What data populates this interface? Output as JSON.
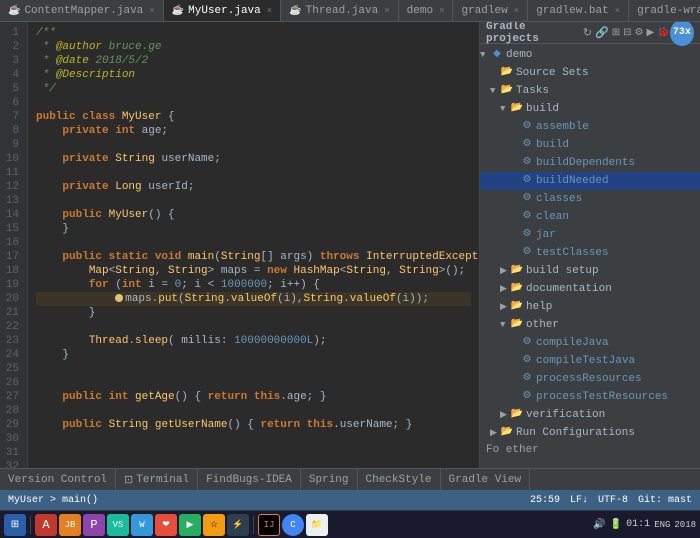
{
  "tabs": [
    {
      "label": "ContentMapper.java",
      "icon": "☕",
      "active": false
    },
    {
      "label": "MyUser.java",
      "icon": "☕",
      "active": true
    },
    {
      "label": "Thread.java",
      "icon": "☕",
      "active": false
    },
    {
      "label": "demo",
      "icon": "📁",
      "active": false
    },
    {
      "label": "gradlew",
      "icon": "📄",
      "active": false
    },
    {
      "label": "gradlew.bat",
      "icon": "📄",
      "active": false
    },
    {
      "label": "gradle-wrapper.properties",
      "icon": "📄",
      "active": false
    }
  ],
  "editor": {
    "filename": "MyUser.java",
    "breadcrumb": "MyUser > main()"
  },
  "gradle": {
    "title": "Gradle projects",
    "for_other_label": "Fo ether"
  },
  "gradle_tree": {
    "items": [
      {
        "level": 0,
        "arrow": "▼",
        "icon": "🔷",
        "label": "demo",
        "selected": false
      },
      {
        "level": 1,
        "arrow": "",
        "icon": "📁",
        "label": "Source Sets",
        "selected": false
      },
      {
        "level": 1,
        "arrow": "▼",
        "icon": "📁",
        "label": "Tasks",
        "selected": false
      },
      {
        "level": 2,
        "arrow": "▼",
        "icon": "📁",
        "label": "build",
        "selected": false
      },
      {
        "level": 3,
        "arrow": "",
        "icon": "⚙",
        "label": "assemble",
        "task": true,
        "selected": false
      },
      {
        "level": 3,
        "arrow": "",
        "icon": "⚙",
        "label": "build",
        "task": true,
        "selected": false
      },
      {
        "level": 3,
        "arrow": "",
        "icon": "⚙",
        "label": "buildDependents",
        "task": true,
        "selected": false
      },
      {
        "level": 3,
        "arrow": "",
        "icon": "⚙",
        "label": "buildNeeded",
        "task": true,
        "selected": true
      },
      {
        "level": 3,
        "arrow": "",
        "icon": "⚙",
        "label": "classes",
        "task": true,
        "selected": false
      },
      {
        "level": 3,
        "arrow": "",
        "icon": "⚙",
        "label": "clean",
        "task": true,
        "selected": false
      },
      {
        "level": 3,
        "arrow": "",
        "icon": "⚙",
        "label": "jar",
        "task": true,
        "selected": false
      },
      {
        "level": 3,
        "arrow": "",
        "icon": "⚙",
        "label": "testClasses",
        "task": true,
        "selected": false
      },
      {
        "level": 2,
        "arrow": "▶",
        "icon": "📁",
        "label": "build setup",
        "selected": false
      },
      {
        "level": 2,
        "arrow": "▶",
        "icon": "📁",
        "label": "documentation",
        "selected": false
      },
      {
        "level": 2,
        "arrow": "▶",
        "icon": "📁",
        "label": "help",
        "selected": false
      },
      {
        "level": 2,
        "arrow": "▼",
        "icon": "📁",
        "label": "other",
        "selected": false
      },
      {
        "level": 3,
        "arrow": "",
        "icon": "⚙",
        "label": "compileJava",
        "task": true,
        "selected": false
      },
      {
        "level": 3,
        "arrow": "",
        "icon": "⚙",
        "label": "compileTestJava",
        "task": true,
        "selected": false
      },
      {
        "level": 3,
        "arrow": "",
        "icon": "⚙",
        "label": "processResources",
        "task": true,
        "selected": false
      },
      {
        "level": 3,
        "arrow": "",
        "icon": "⚙",
        "label": "processTestResources",
        "task": true,
        "selected": false
      },
      {
        "level": 2,
        "arrow": "▶",
        "icon": "📁",
        "label": "verification",
        "selected": false
      },
      {
        "level": 1,
        "arrow": "▶",
        "icon": "📁",
        "label": "Run Configurations",
        "selected": false
      }
    ]
  },
  "bottom_tabs": [
    {
      "label": "Version Control",
      "active": false
    },
    {
      "label": "Terminal",
      "active": false
    },
    {
      "label": "FindBugs-IDEA",
      "active": false
    },
    {
      "label": "Spring",
      "active": false
    },
    {
      "label": "CheckStyle",
      "active": false
    },
    {
      "label": "Gradle View",
      "active": false
    }
  ],
  "status_bar": {
    "position": "25:59",
    "line_info": "LF↓",
    "encoding": "UTF-8",
    "filetype": "Git: mast",
    "column": "1F↓"
  },
  "taskbar": {
    "time": "01:1",
    "date": "2018"
  },
  "avatar": {
    "initials": "73",
    "color": "#4a90d9"
  }
}
